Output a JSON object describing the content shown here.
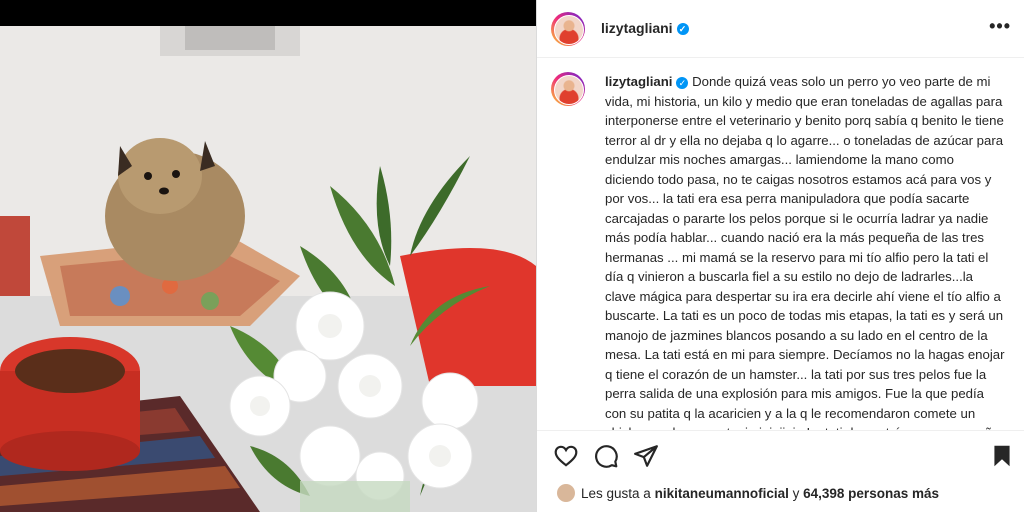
{
  "post": {
    "username": "lizytagliani",
    "more_label": "•••",
    "caption": "Donde quizá veas solo un perro yo veo parte de mi vida, mi historia, un kilo y medio que eran toneladas de agallas para interponerse entre el veterinario y benito porq sabía q benito le tiene terror al dr y ella no dejaba q lo agarre... o toneladas de azúcar para endulzar mis noches amargas... lamiendome la mano como diciendo todo pasa, no te caigas nosotros estamos acá para vos y por vos... la tati era esa perra manipuladora que podía sacarte carcajadas o pararte los pelos porque si le ocurría ladrar ya nadie más podía hablar... cuando nació era la más pequeña de las tres hermanas ... mi mamá se la reservo para mi tío alfio pero la tati el día q vinieron a buscarla fiel a su estilo no dejo de ladrarles...la clave mágica para despertar su ira era decirle ahí viene el tío alfio a buscarte. La tati es un poco de todas mis etapas, la tati es y será un manojo de jazmines blancos posando a su lado en el centro de la mesa. La tati está en mi para siempre. Decíamos no la hagas enojar q tiene el corazón de un hamster... la tati por sus tres pelos fue la perra salida de una explosión para mis amigos. Fue la que pedía con su patita q la acaricien y a la q le recomendaron comete un chicle por el puma q tenia jajajjaja La tati demostró que su pequeño"
  },
  "likes": {
    "prefix": "Les gusta a",
    "user": "nikitaneumannoficial",
    "middle": "y",
    "count": "64,398 personas más"
  },
  "icons": [
    "heart-icon",
    "comment-icon",
    "share-icon",
    "bookmark-icon",
    "verified-icon"
  ]
}
